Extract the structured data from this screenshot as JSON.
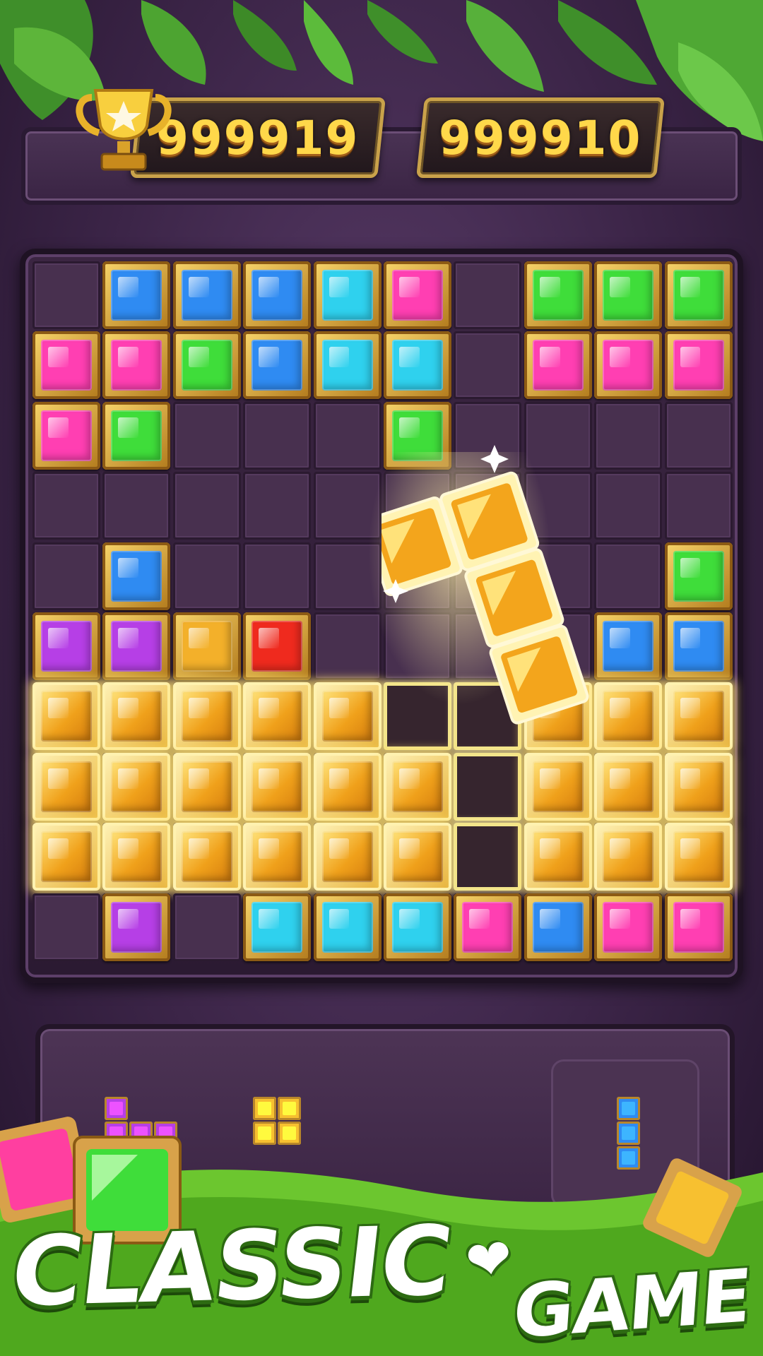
{
  "scores": {
    "best": "999919",
    "current": "999910"
  },
  "board": {
    "rows": [
      [
        "empty",
        "blue",
        "blue",
        "blue",
        "cyan",
        "pink",
        "empty",
        "green",
        "green",
        "green"
      ],
      [
        "pink",
        "pink",
        "green",
        "blue",
        "cyan",
        "cyan",
        "empty",
        "pink",
        "pink",
        "pink"
      ],
      [
        "pink",
        "green",
        "empty",
        "empty",
        "empty",
        "green",
        "empty",
        "empty",
        "empty",
        "empty"
      ],
      [
        "empty",
        "empty",
        "empty",
        "empty",
        "empty",
        "empty",
        "empty",
        "empty",
        "empty",
        "empty"
      ],
      [
        "empty",
        "blue",
        "empty",
        "empty",
        "empty",
        "empty",
        "empty",
        "empty",
        "empty",
        "green"
      ],
      [
        "purple",
        "purple",
        "orange",
        "red",
        "empty",
        "empty",
        "empty",
        "empty",
        "blue",
        "blue"
      ],
      [
        "gold",
        "gold",
        "gold",
        "gold",
        "gold",
        "hole",
        "hole",
        "gold",
        "gold",
        "gold"
      ],
      [
        "gold",
        "gold",
        "gold",
        "gold",
        "gold",
        "gold",
        "hole",
        "gold",
        "gold",
        "gold"
      ],
      [
        "gold",
        "gold",
        "gold",
        "gold",
        "gold",
        "gold",
        "hole",
        "gold",
        "gold",
        "gold"
      ],
      [
        "empty",
        "purple",
        "empty",
        "cyan",
        "cyan",
        "cyan",
        "pink",
        "blue",
        "pink",
        "pink"
      ]
    ]
  },
  "dragged_piece": {
    "color": "gold",
    "shape": "S-tetromino"
  },
  "tray": {
    "pieces": [
      {
        "shape": "L",
        "color": "purple"
      },
      {
        "shape": "square-2x2",
        "color": "gold"
      },
      {
        "shape": "vertical-3",
        "color": "blue"
      }
    ]
  },
  "colors": {
    "blue": "#2f8bf2",
    "cyan": "#2fd1ee",
    "pink": "#ff3fb2",
    "green": "#3fdd3a",
    "purple": "#b63fe6",
    "orange": "#f3b02a",
    "red": "#ef2a1e",
    "gold": "#f7c030",
    "frame": "#d8a24a"
  },
  "banner": {
    "word1": "CLASSIC",
    "heart": "❤",
    "word2": "GAME"
  },
  "icons": [
    "trophy-icon",
    "leaf-icon",
    "heart-icon"
  ]
}
